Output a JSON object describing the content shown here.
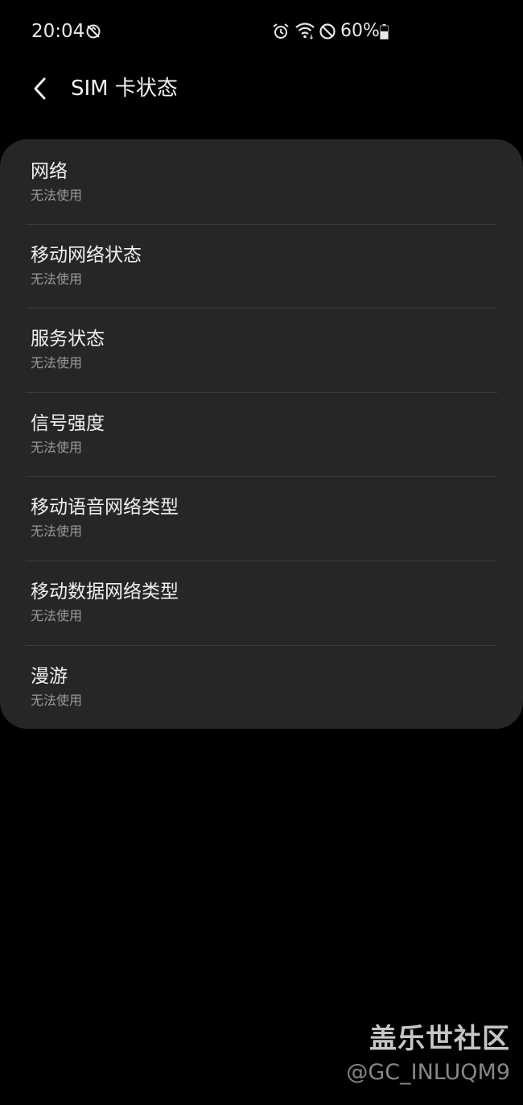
{
  "status_bar": {
    "time": "20:04",
    "left_icon": "sync-off-icon",
    "icons": [
      "alarm-icon",
      "wifi-icon",
      "do-not-disturb-icon"
    ],
    "battery_text": "60%",
    "battery_level": 0.6
  },
  "header": {
    "back_icon": "back-chevron-icon",
    "title": "SIM 卡状态"
  },
  "items": [
    {
      "title": "网络",
      "subtitle": "无法使用"
    },
    {
      "title": "移动网络状态",
      "subtitle": "无法使用"
    },
    {
      "title": "服务状态",
      "subtitle": "无法使用"
    },
    {
      "title": "信号强度",
      "subtitle": "无法使用"
    },
    {
      "title": "移动语音网络类型",
      "subtitle": "无法使用"
    },
    {
      "title": "移动数据网络类型",
      "subtitle": "无法使用"
    },
    {
      "title": "漫游",
      "subtitle": "无法使用"
    }
  ],
  "watermark": {
    "title": "盖乐世社区",
    "handle": "@GC_INLUQM9"
  },
  "colors": {
    "background": "#000000",
    "card": "#262626",
    "divider": "#3d3d3d",
    "text_primary": "#f0f0f0",
    "text_secondary": "#9a9a9a"
  }
}
